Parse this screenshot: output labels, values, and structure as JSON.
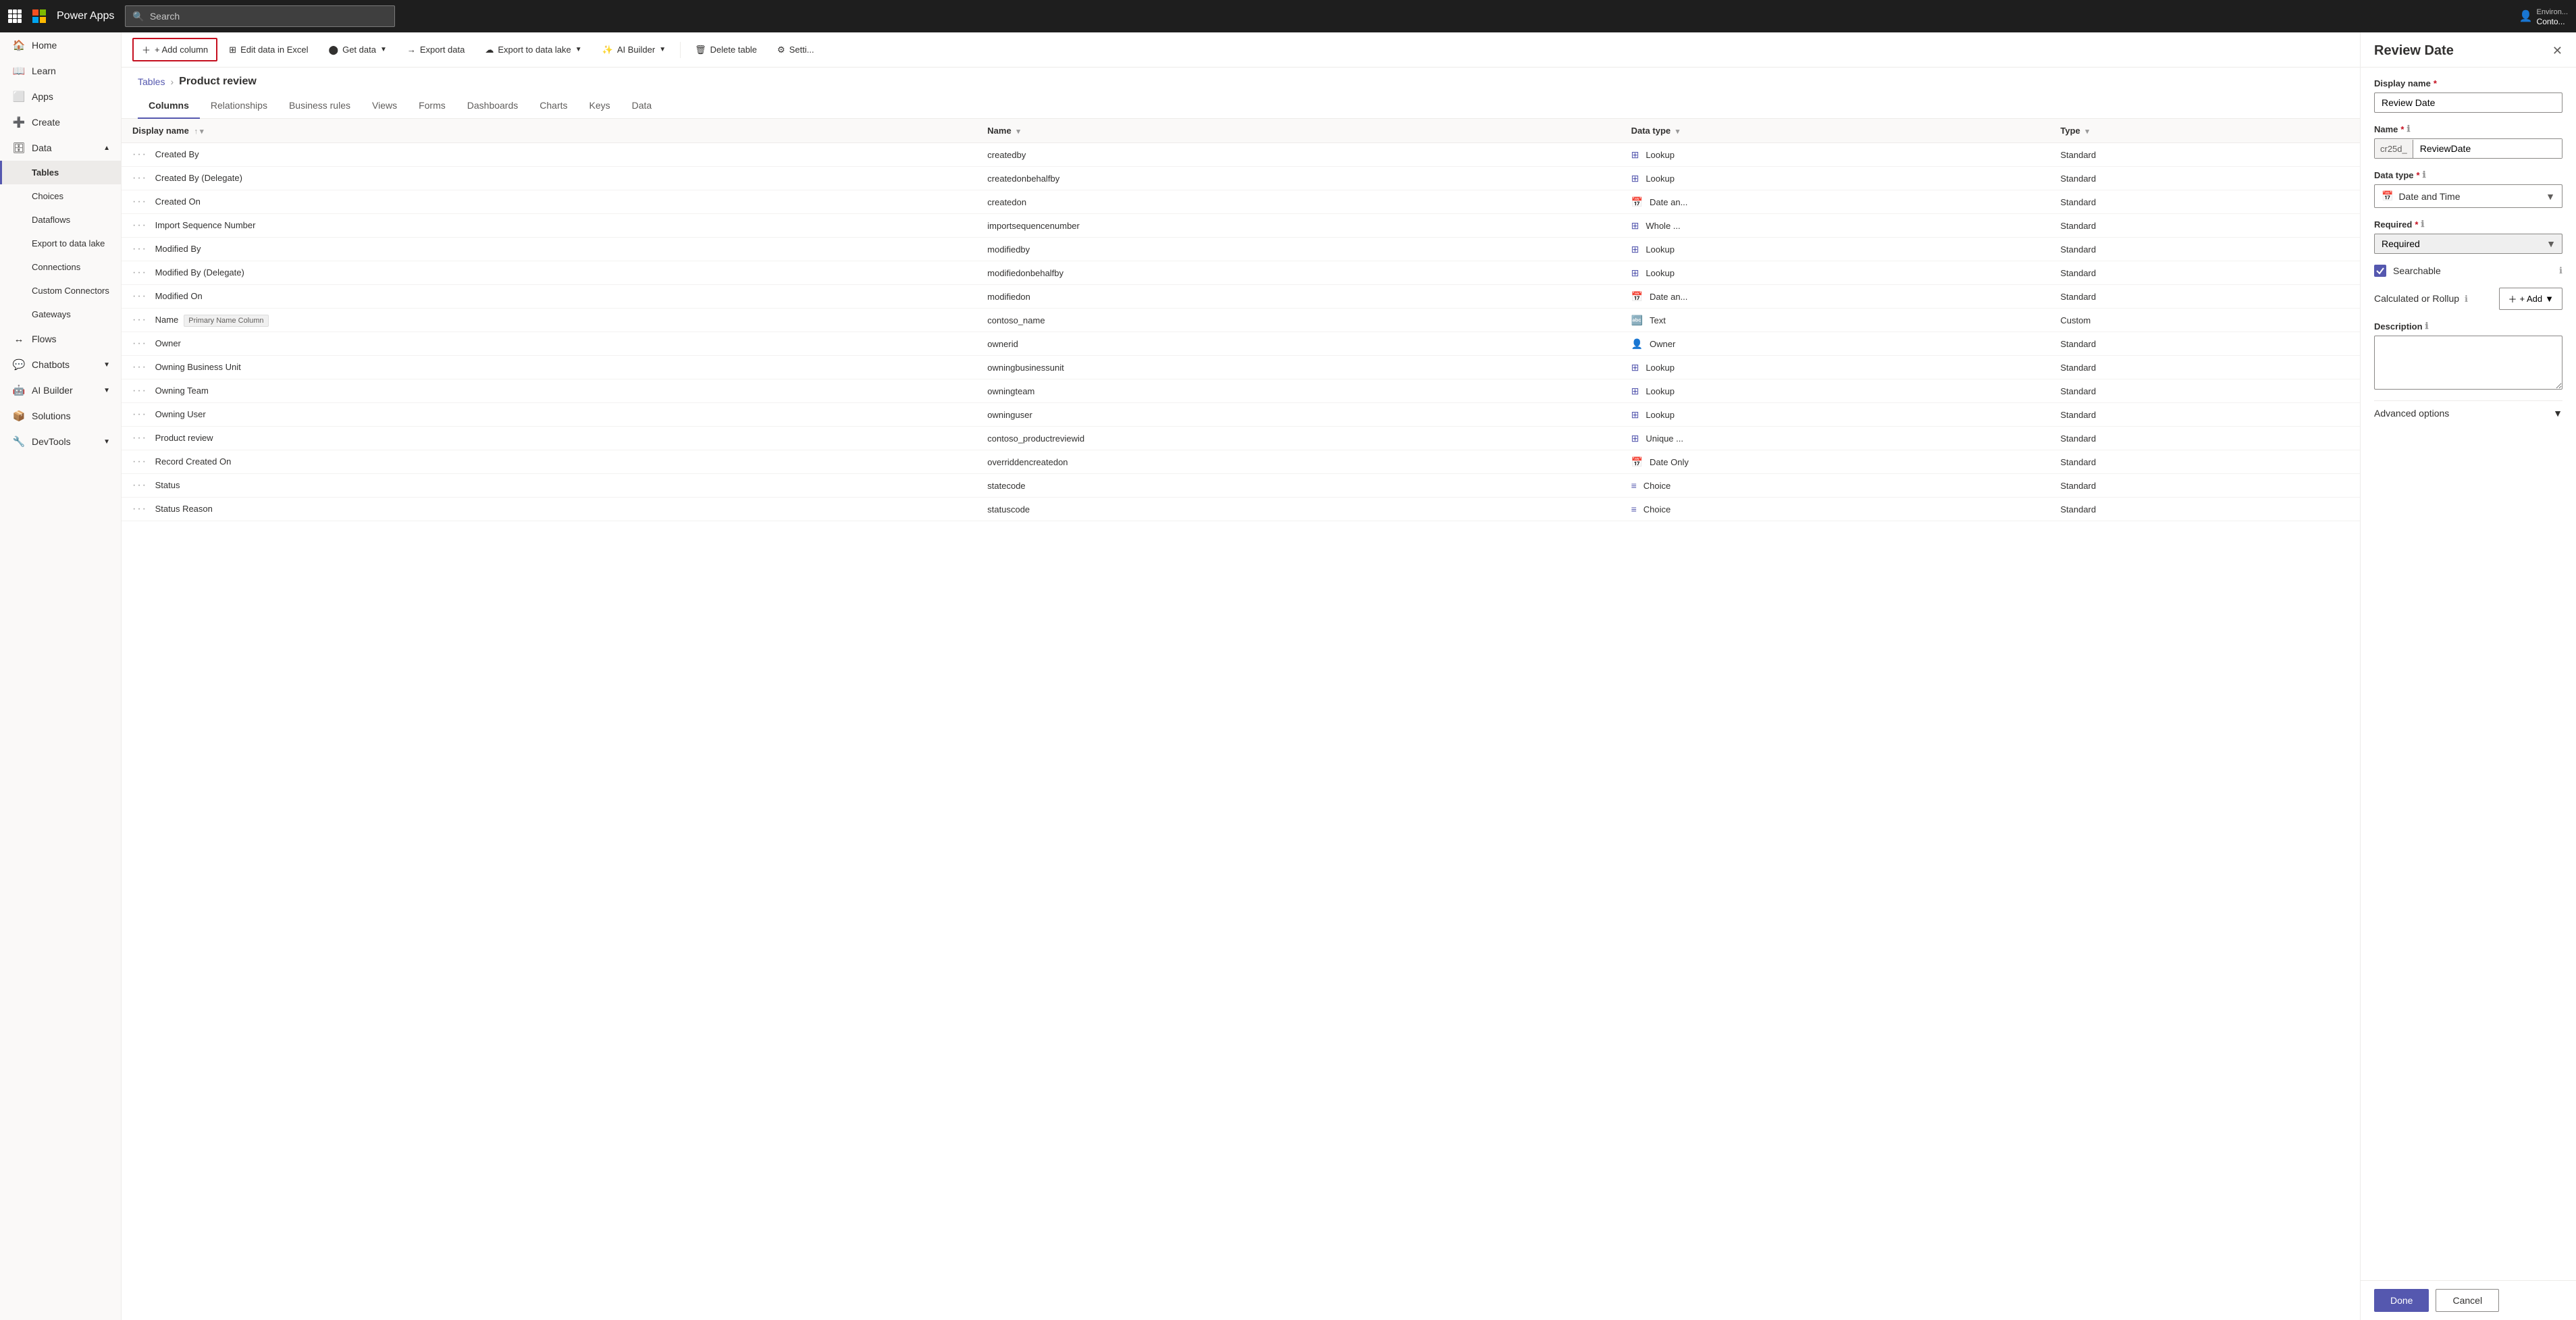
{
  "topnav": {
    "app_name": "Power Apps",
    "search_placeholder": "Search",
    "env_label": "Environ...",
    "user_label": "Conto..."
  },
  "sidebar": {
    "items": [
      {
        "id": "home",
        "label": "Home",
        "icon": "🏠",
        "active": false
      },
      {
        "id": "learn",
        "label": "Learn",
        "icon": "📖",
        "active": false
      },
      {
        "id": "apps",
        "label": "Apps",
        "icon": "⬜",
        "active": false
      },
      {
        "id": "create",
        "label": "Create",
        "icon": "➕",
        "active": false
      },
      {
        "id": "data",
        "label": "Data",
        "icon": "🗄",
        "active": true,
        "expandable": true,
        "expanded": true
      },
      {
        "id": "tables",
        "label": "Tables",
        "indent": true,
        "active": true
      },
      {
        "id": "choices",
        "label": "Choices",
        "indent": true,
        "active": false
      },
      {
        "id": "dataflows",
        "label": "Dataflows",
        "indent": true,
        "active": false
      },
      {
        "id": "export-lake",
        "label": "Export to data lake",
        "indent": true,
        "active": false
      },
      {
        "id": "connections",
        "label": "Connections",
        "indent": true,
        "active": false
      },
      {
        "id": "custom-connectors",
        "label": "Custom Connectors",
        "indent": true,
        "active": false
      },
      {
        "id": "gateways",
        "label": "Gateways",
        "indent": true,
        "active": false
      },
      {
        "id": "flows",
        "label": "Flows",
        "icon": "↔",
        "active": false
      },
      {
        "id": "chatbots",
        "label": "Chatbots",
        "icon": "💬",
        "active": false,
        "expandable": true
      },
      {
        "id": "ai-builder",
        "label": "AI Builder",
        "icon": "🤖",
        "active": false,
        "expandable": true
      },
      {
        "id": "solutions",
        "label": "Solutions",
        "icon": "📦",
        "active": false
      },
      {
        "id": "devtools",
        "label": "DevTools",
        "icon": "🔧",
        "active": false,
        "expandable": true
      }
    ]
  },
  "toolbar": {
    "add_column": "+ Add column",
    "edit_excel": "Edit data in Excel",
    "get_data": "Get data",
    "export_data": "Export data",
    "export_data_lake": "Export to data lake",
    "ai_builder": "AI Builder",
    "delete_table": "Delete table",
    "settings": "Setti..."
  },
  "breadcrumb": {
    "parent": "Tables",
    "current": "Product review"
  },
  "tabs": [
    {
      "id": "columns",
      "label": "Columns",
      "active": true
    },
    {
      "id": "relationships",
      "label": "Relationships",
      "active": false
    },
    {
      "id": "business-rules",
      "label": "Business rules",
      "active": false
    },
    {
      "id": "views",
      "label": "Views",
      "active": false
    },
    {
      "id": "forms",
      "label": "Forms",
      "active": false
    },
    {
      "id": "dashboards",
      "label": "Dashboards",
      "active": false
    },
    {
      "id": "charts",
      "label": "Charts",
      "active": false
    },
    {
      "id": "keys",
      "label": "Keys",
      "active": false
    },
    {
      "id": "data",
      "label": "Data",
      "active": false
    }
  ],
  "table_headers": [
    {
      "id": "display-name",
      "label": "Display name",
      "sortable": true
    },
    {
      "id": "name",
      "label": "Name",
      "sortable": true
    },
    {
      "id": "data-type",
      "label": "Data type",
      "sortable": true
    },
    {
      "id": "type",
      "label": "Type",
      "sortable": true
    }
  ],
  "table_rows": [
    {
      "display_name": "Created By",
      "name": "createdby",
      "data_type": "Lookup",
      "data_type_icon": "⊞",
      "type": "Standard",
      "primary": false
    },
    {
      "display_name": "Created By (Delegate)",
      "name": "createdonbehalfby",
      "data_type": "Lookup",
      "data_type_icon": "⊞",
      "type": "Standard",
      "primary": false
    },
    {
      "display_name": "Created On",
      "name": "createdon",
      "data_type": "Date an...",
      "data_type_icon": "📅",
      "type": "Standard",
      "primary": false
    },
    {
      "display_name": "Import Sequence Number",
      "name": "importsequencenumber",
      "data_type": "Whole ...",
      "data_type_icon": "⊞",
      "type": "Standard",
      "primary": false
    },
    {
      "display_name": "Modified By",
      "name": "modifiedby",
      "data_type": "Lookup",
      "data_type_icon": "⊞",
      "type": "Standard",
      "primary": false
    },
    {
      "display_name": "Modified By (Delegate)",
      "name": "modifiedonbehalfby",
      "data_type": "Lookup",
      "data_type_icon": "⊞",
      "type": "Standard",
      "primary": false
    },
    {
      "display_name": "Modified On",
      "name": "modifiedon",
      "data_type": "Date an...",
      "data_type_icon": "📅",
      "type": "Standard",
      "primary": false
    },
    {
      "display_name": "Name",
      "name": "contoso_name",
      "data_type": "Text",
      "data_type_icon": "🔤",
      "type": "Custom",
      "primary": true,
      "primary_label": "Primary Name Column"
    },
    {
      "display_name": "Owner",
      "name": "ownerid",
      "data_type": "Owner",
      "data_type_icon": "👤",
      "type": "Standard",
      "primary": false
    },
    {
      "display_name": "Owning Business Unit",
      "name": "owningbusinessunit",
      "data_type": "Lookup",
      "data_type_icon": "⊞",
      "type": "Standard",
      "primary": false
    },
    {
      "display_name": "Owning Team",
      "name": "owningteam",
      "data_type": "Lookup",
      "data_type_icon": "⊞",
      "type": "Standard",
      "primary": false
    },
    {
      "display_name": "Owning User",
      "name": "owninguser",
      "data_type": "Lookup",
      "data_type_icon": "⊞",
      "type": "Standard",
      "primary": false
    },
    {
      "display_name": "Product review",
      "name": "contoso_productreviewid",
      "data_type": "Unique ...",
      "data_type_icon": "⊞",
      "type": "Standard",
      "primary": false
    },
    {
      "display_name": "Record Created On",
      "name": "overriddencreatedon",
      "data_type": "Date Only",
      "data_type_icon": "📅",
      "type": "Standard",
      "primary": false
    },
    {
      "display_name": "Status",
      "name": "statecode",
      "data_type": "Choice",
      "data_type_icon": "≡",
      "type": "Standard",
      "primary": false
    },
    {
      "display_name": "Status Reason",
      "name": "statuscode",
      "data_type": "Choice",
      "data_type_icon": "≡",
      "type": "Standard",
      "primary": false
    }
  ],
  "panel": {
    "title": "Review Date",
    "display_name_label": "Display name",
    "display_name_value": "Review Date",
    "name_label": "Name",
    "name_prefix": "cr25d_",
    "name_value": "ReviewDate",
    "data_type_label": "Data type",
    "data_type_value": "Date and Time",
    "data_type_icon": "📅",
    "required_label": "Required",
    "required_value": "Required",
    "searchable_label": "Searchable",
    "searchable_checked": true,
    "calculated_label": "Calculated or Rollup",
    "add_label": "+ Add",
    "description_label": "Description",
    "description_placeholder": "",
    "advanced_label": "Advanced options",
    "done_label": "Done",
    "cancel_label": "Cancel"
  }
}
